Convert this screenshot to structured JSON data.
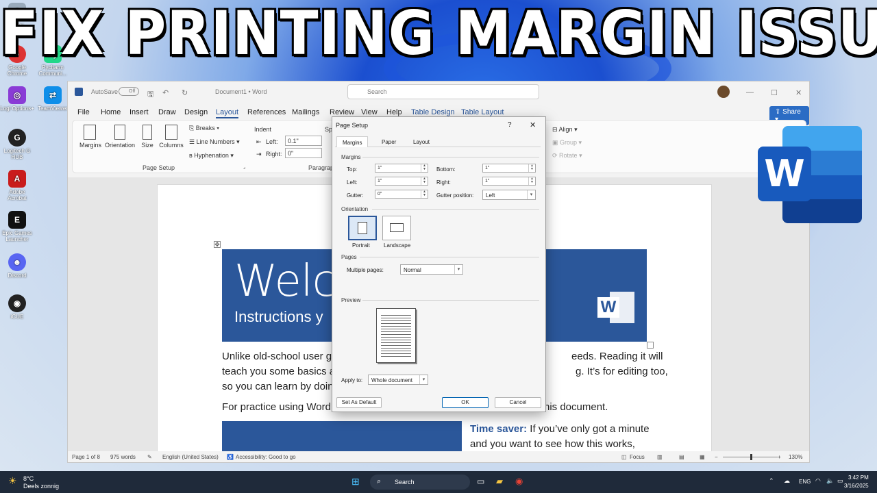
{
  "overlay_title": "FIX PRINTING MARGIN ISSUE",
  "desktop": {
    "icons": [
      "Recy",
      "Google Chrome",
      "Logi Options+",
      "Logitech G HUB",
      "Adobe Acrobat",
      "Epic Games Launcher",
      "Discord",
      "iCUE",
      "Pycharm Communi...",
      "TeamViewer"
    ]
  },
  "word": {
    "autosave_label": "AutoSave",
    "autosave_state": "Off",
    "doc_title": "Document1 • Word",
    "search_placeholder": "Search",
    "menu": [
      "File",
      "Home",
      "Insert",
      "Draw",
      "Design",
      "Layout",
      "References",
      "Mailings",
      "Review",
      "View",
      "Help",
      "Table Design",
      "Table Layout"
    ],
    "share_label": "Share",
    "ribbon": {
      "margins": "Margins",
      "orientation": "Orientation",
      "size": "Size",
      "columns": "Columns",
      "breaks": "Breaks",
      "line_numbers": "Line Numbers",
      "hyphenation": "Hyphenation",
      "page_setup_group": "Page Setup",
      "indent_label": "Indent",
      "indent_left_label": "Left:",
      "indent_left_value": "0.1\"",
      "indent_right_label": "Right:",
      "indent_right_value": "0\"",
      "spacing_partial": "Sp",
      "paragraph_group": "Paragrap",
      "align": "Align",
      "group": "Group",
      "rotate": "Rotate"
    },
    "document": {
      "banner_big": "Welco                d",
      "banner_sub": "Instructions y",
      "line1a": "Unlike old-school user gu",
      "line1b": "eeds. Reading it will",
      "line2a": "teach you some basics ab",
      "line2b": "g. It’s for editing too,",
      "line3a": "so you can learn by doing",
      "line4a": "For practice using Word",
      "line4b": "his document.",
      "time_saver_bold": "Time saver:",
      "time_saver_text": " If you’ve only got a minute",
      "time_saver_line2": "and you want to see how this works,"
    },
    "status": {
      "page": "Page 1 of 8",
      "words": "975 words",
      "language": "English (United States)",
      "accessibility": "Accessibility: Good to go",
      "focus": "Focus",
      "zoom": "130%"
    }
  },
  "dialog": {
    "title": "Page Setup",
    "help": "?",
    "close": "✕",
    "tabs": [
      "Margins",
      "Paper",
      "Layout"
    ],
    "margins_section": "Margins",
    "top_label": "Top:",
    "top_value": "1\"",
    "bottom_label": "Bottom:",
    "bottom_value": "1\"",
    "left_label": "Left:",
    "left_value": "1\"",
    "right_label": "Right:",
    "right_value": "1\"",
    "gutter_label": "Gutter:",
    "gutter_value": "0\"",
    "gutter_pos_label": "Gutter position:",
    "gutter_pos_value": "Left",
    "orientation_section": "Orientation",
    "portrait": "Portrait",
    "landscape": "Landscape",
    "pages_section": "Pages",
    "multiple_pages_label": "Multiple pages:",
    "multiple_pages_value": "Normal",
    "preview_section": "Preview",
    "apply_to_label": "Apply to:",
    "apply_to_value": "Whole document",
    "set_default": "Set As Default",
    "ok": "OK",
    "cancel": "Cancel"
  },
  "taskbar": {
    "weather_temp": "8°C",
    "weather_desc": "Deels zonnig",
    "search": "Search",
    "lang": "ENG",
    "time": "3:42 PM",
    "date": "3/16/2025"
  },
  "colors": {
    "word_blue": "#2b579a",
    "accent": "#0063b1"
  }
}
